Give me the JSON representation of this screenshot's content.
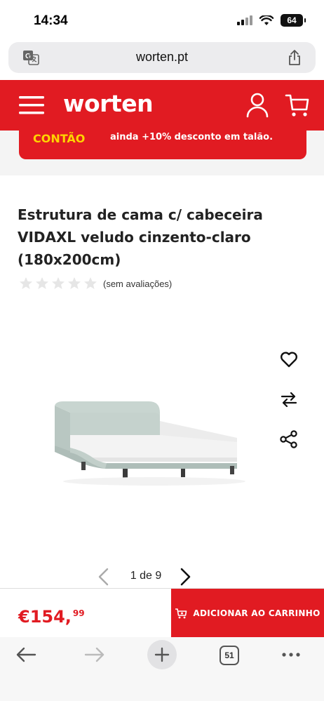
{
  "status_bar": {
    "time": "14:34",
    "battery": "64"
  },
  "url_bar": {
    "url": "worten.pt"
  },
  "header": {
    "logo": "worten",
    "promo_left": "CONTÃO",
    "promo_right": "ainda +10% desconto em talão."
  },
  "product": {
    "title": "Estrutura de cama c/ cabeceira VIDAXL veludo cinzento-claro (180x200cm)",
    "rating_stars": 0,
    "rating_max": 5,
    "rating_text": "(sem avaliações)"
  },
  "gallery": {
    "pager_text": "1 de 9",
    "current": 1,
    "total": 9
  },
  "buy_bar": {
    "price_main": "€154,",
    "price_cents": "99",
    "add_to_cart_label": "ADICIONAR AO CARRINHO"
  },
  "browser_toolbar": {
    "tab_count": "51"
  },
  "colors": {
    "brand_red": "#e11b22",
    "promo_yellow": "#ffd400",
    "star_empty": "#e6e6e6"
  },
  "icons": [
    "translate-icon",
    "share-icon",
    "menu-icon",
    "user-icon",
    "cart-icon",
    "heart-icon",
    "compare-icon",
    "share-network-icon",
    "chevron-left-icon",
    "chevron-right-icon",
    "cart-add-icon",
    "back-arrow-icon",
    "forward-arrow-icon",
    "plus-icon",
    "tabs-icon",
    "more-icon"
  ]
}
